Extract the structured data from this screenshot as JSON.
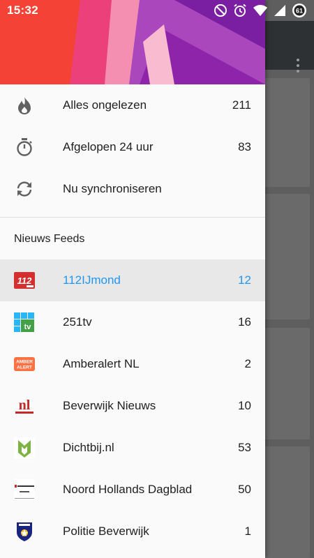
{
  "status_bar": {
    "time": "15:32",
    "battery_level": "61"
  },
  "drawer": {
    "top_items": [
      {
        "label": "Alles ongelezen",
        "count": "211",
        "icon": "flame-icon"
      },
      {
        "label": "Afgelopen 24 uur",
        "count": "83",
        "icon": "stopwatch-icon"
      },
      {
        "label": "Nu synchroniseren",
        "count": "",
        "icon": "sync-icon"
      }
    ],
    "section_title": "Nieuws Feeds",
    "feeds": [
      {
        "label": "112IJmond",
        "count": "12",
        "icon": "112-logo-icon",
        "active": true
      },
      {
        "label": "251tv",
        "count": "16",
        "icon": "251tv-logo-icon"
      },
      {
        "label": "Amberalert NL",
        "count": "2",
        "icon": "amber-alert-logo-icon"
      },
      {
        "label": "Beverwijk Nieuws",
        "count": "10",
        "icon": "nl-nieuws-logo-icon"
      },
      {
        "label": "Dichtbij.nl",
        "count": "53",
        "icon": "dichtbij-logo-icon"
      },
      {
        "label": "Noord Hollands Dagblad",
        "count": "50",
        "icon": "noordhollands-dagblad-logo-icon"
      },
      {
        "label": "Politie Beverwijk",
        "count": "1",
        "icon": "politie-logo-icon"
      }
    ]
  },
  "colors": {
    "accent": "#2196f3",
    "active_row_bg": "#e8e8e8",
    "drawer_bg": "#fafafa",
    "toolbar_bg": "#2d3133"
  }
}
